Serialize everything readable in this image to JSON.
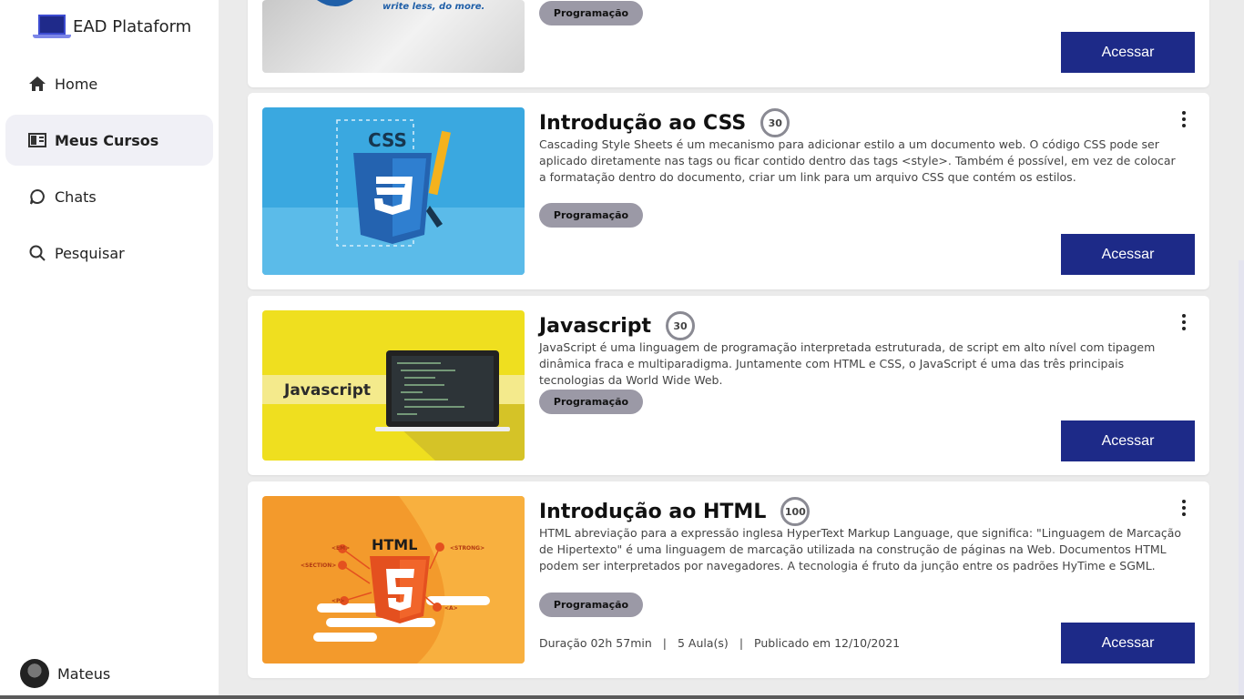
{
  "app": {
    "name": "EAD Plataform"
  },
  "nav": [
    {
      "label": "Home",
      "icon": "home-icon"
    },
    {
      "label": "Meus Cursos",
      "icon": "courses-icon",
      "active": true
    },
    {
      "label": "Chats",
      "icon": "chat-icon"
    },
    {
      "label": "Pesquisar",
      "icon": "search-icon"
    }
  ],
  "user": {
    "name": "Mateus"
  },
  "colors": {
    "accent": "#1d2a88",
    "tag": "#9b99a6"
  },
  "courses": [
    {
      "image_caption": "write less, do more.",
      "tag": "Programação",
      "button": "Acessar"
    },
    {
      "title": "Introdução ao CSS",
      "count": "30",
      "image_caption": "CSS",
      "description": "Cascading Style Sheets é um mecanismo para adicionar estilo a um documento web. O código CSS pode ser aplicado diretamente nas tags ou ficar contido dentro das tags <style>. Também é possível, em vez de colocar a formatação dentro do documento, criar um link para um arquivo CSS que contém os estilos.",
      "tag": "Programação",
      "button": "Acessar"
    },
    {
      "title": "Javascript",
      "count": "30",
      "image_caption": "Javascript",
      "description": "JavaScript é uma linguagem de programação interpretada estruturada, de script em alto nível com tipagem dinâmica fraca e multiparadigma. Juntamente com HTML e CSS, o JavaScript é uma das três principais tecnologias da World Wide Web.",
      "tag": "Programação",
      "button": "Acessar"
    },
    {
      "title": "Introdução ao HTML",
      "count": "100",
      "image_caption": "HTML",
      "image_labels": [
        "<EM>",
        "<STRONG>",
        "<SECTION>",
        "<P>",
        "<A>"
      ],
      "description": "HTML abreviação para a expressão inglesa HyperText Markup Language, que significa: \"Linguagem de Marcação de Hipertexto\" é uma linguagem de marcação utilizada na construção de páginas na Web. Documentos HTML podem ser interpretados por navegadores. A tecnologia é fruto da junção entre os padrões HyTime e SGML.",
      "tag": "Programação",
      "duration": "Duração 02h 57min",
      "lessons": "5 Aula(s)",
      "published": "Publicado em 12/10/2021",
      "separator": "|",
      "button": "Acessar"
    }
  ]
}
